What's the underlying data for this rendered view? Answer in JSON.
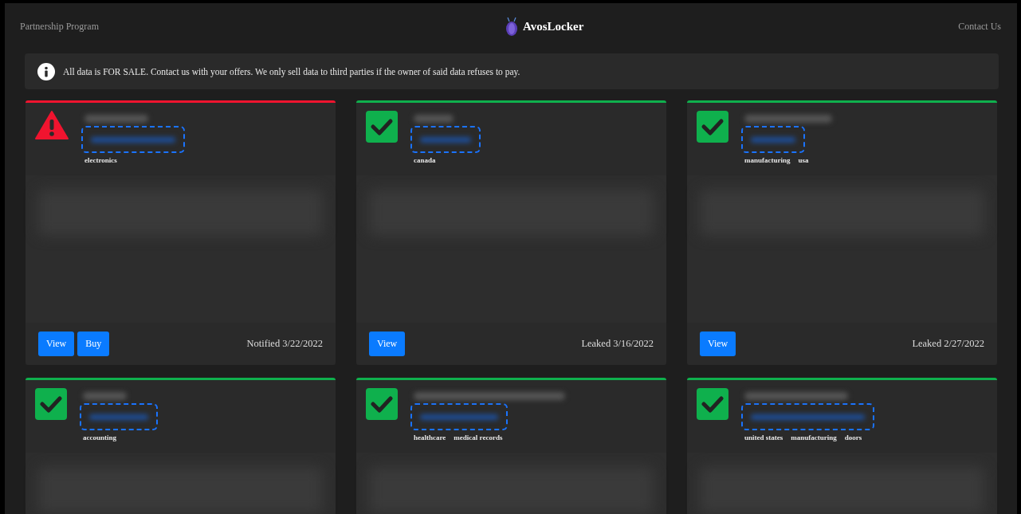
{
  "nav": {
    "left_link": "Partnership Program",
    "brand": "AvosLocker",
    "right_link": "Contact Us"
  },
  "notice": {
    "text": "All data is FOR SALE. Contact us with your offers. We only sell data to third parties if the owner of said data refuses to pay."
  },
  "cards": [
    {
      "kind": "warning",
      "tags": [
        "electronics"
      ],
      "buttons": [
        "View",
        "Buy"
      ],
      "date": "Notified 3/22/2022"
    },
    {
      "kind": "leaked",
      "tags": [
        "canada"
      ],
      "buttons": [
        "View"
      ],
      "date": "Leaked 3/16/2022"
    },
    {
      "kind": "leaked",
      "tags": [
        "manufacturing",
        "usa"
      ],
      "buttons": [
        "View"
      ],
      "date": "Leaked 2/27/2022"
    },
    {
      "kind": "leaked",
      "tags": [
        "accounting"
      ]
    },
    {
      "kind": "leaked",
      "tags": [
        "healthcare",
        "medical records"
      ]
    },
    {
      "kind": "leaked",
      "tags": [
        "united states",
        "manufacturing",
        "doors"
      ]
    }
  ]
}
